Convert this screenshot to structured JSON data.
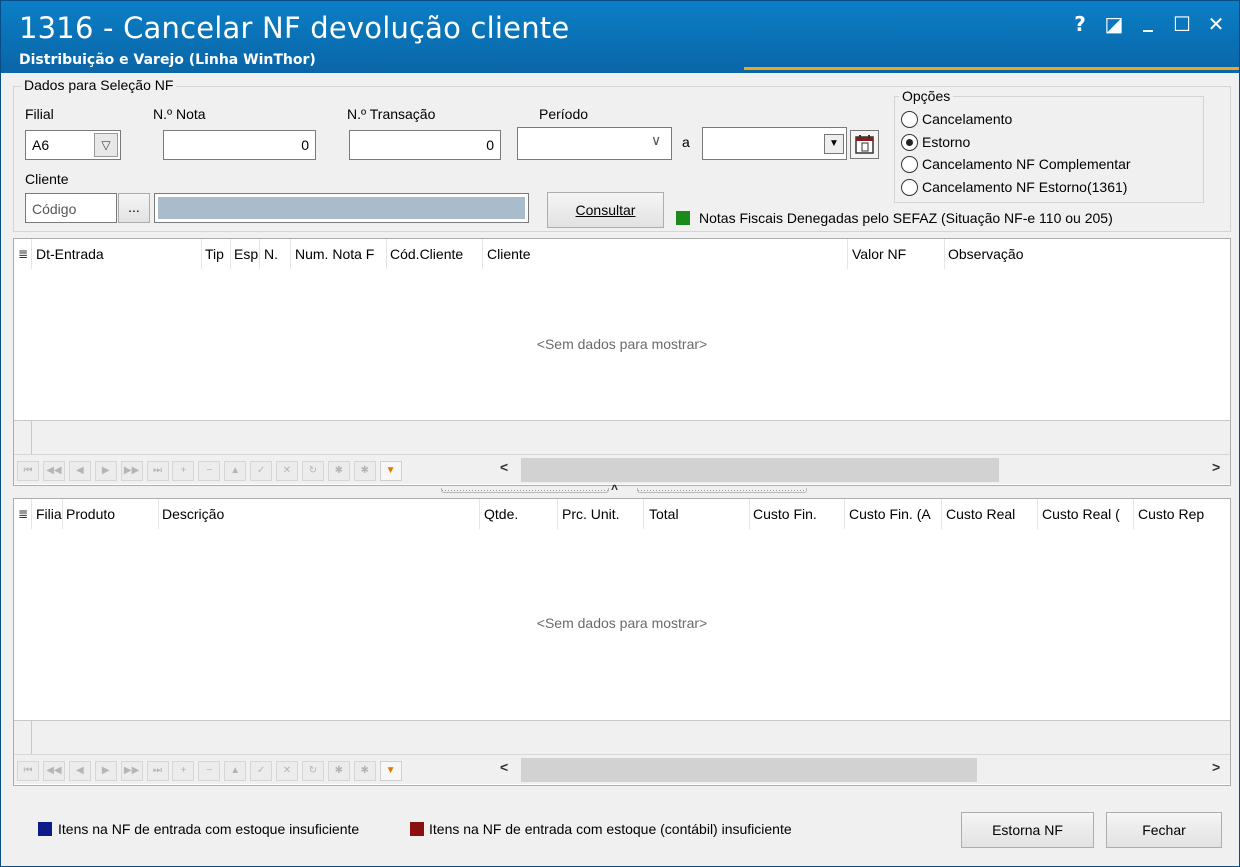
{
  "window": {
    "title": "1316 - Cancelar NF devolução cliente",
    "subtitle": "Distribuição e Varejo (Linha WinThor)",
    "controls": {
      "help": "?",
      "restore_mode": "◪",
      "minimize": "_",
      "maximize": "☐",
      "close": "✕"
    }
  },
  "selection": {
    "group_label": "Dados para Seleção NF",
    "filial_label": "Filial",
    "filial_value": "A6",
    "nota_label": "N.º Nota",
    "nota_value": "0",
    "transacao_label": "N.º Transação",
    "transacao_value": "0",
    "periodo_label": "Período",
    "periodo_from": "",
    "periodo_sep": "a",
    "periodo_to": "",
    "cliente_label": "Cliente",
    "cliente_placeholder": "Código",
    "cliente_lookup": "...",
    "cliente_name": "",
    "consultar_label": "Consultar",
    "sefaz_legend": "Notas Fiscais Denegadas pelo SEFAZ (Situação NF-e 110 ou 205)"
  },
  "options": {
    "label": "Opções",
    "items": [
      {
        "label": "Cancelamento",
        "checked": false
      },
      {
        "label": "Estorno",
        "checked": true
      },
      {
        "label": "Cancelamento NF Complementar",
        "checked": false
      },
      {
        "label": "Cancelamento NF Estorno(1361)",
        "checked": false
      }
    ]
  },
  "notes_grid": {
    "columns": [
      "Dt-Entrada",
      "Tip",
      "Esp",
      "N.",
      "Num. Nota F",
      "Cód.Cliente",
      "Cliente",
      "Valor NF",
      "Observação"
    ],
    "empty_text": "<Sem dados para mostrar>"
  },
  "items_grid": {
    "columns": [
      "Filia",
      "Produto",
      "Descrição",
      "Qtde.",
      "Prc. Unit.",
      "Total",
      "Custo Fin.",
      "Custo Fin. (A",
      "Custo Real",
      "Custo Real (",
      "Custo Rep"
    ],
    "empty_text": "<Sem dados para mostrar>"
  },
  "navigator": {
    "buttons": [
      "first-page",
      "prior-page",
      "prior",
      "next",
      "next-page",
      "last-page",
      "insert",
      "delete",
      "edit",
      "post",
      "cancel",
      "refresh",
      "bookmark",
      "goto-bookmark",
      "filter"
    ],
    "glyphs": [
      "⏮",
      "◀◀",
      "◀",
      "▶",
      "▶▶",
      "⏭",
      "+",
      "−",
      "▲",
      "✓",
      "✕",
      "↻",
      "✱",
      "✱",
      "▼"
    ],
    "scroll_left": "<",
    "scroll_right": ">",
    "splitter_arrow": "^"
  },
  "footer": {
    "legend1": "Itens na NF de entrada com estoque insuficiente",
    "legend2": "Itens na NF de entrada com estoque (contábil) insuficiente",
    "estorna_label": "Estorna NF",
    "fechar_label": "Fechar"
  },
  "colors": {
    "title_bar": "#0a6fb3",
    "accent": "#f2a51c",
    "sefaz_swatch": "#1a8a1a",
    "legend1_swatch": "#0d1a8a",
    "legend2_swatch": "#8a1010",
    "filter_icon": "#e07800"
  }
}
